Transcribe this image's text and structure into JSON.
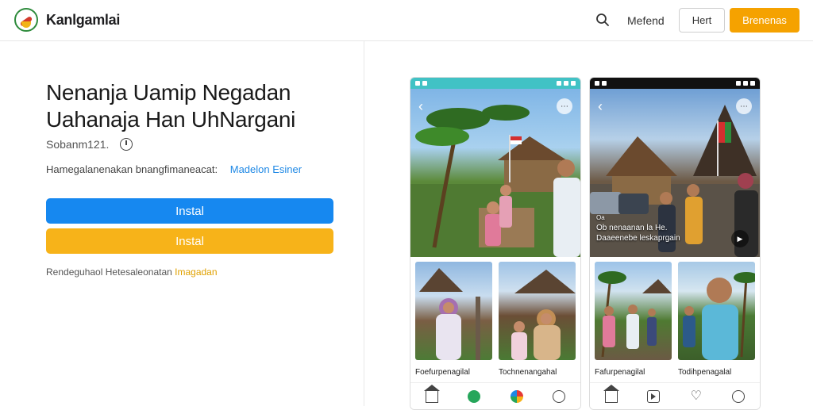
{
  "header": {
    "brand": "Kanlgamlai",
    "nav_link": "Mefend",
    "login_button": "Hert",
    "cta_button": "Brenenas"
  },
  "left": {
    "title_line1": "Nenanja Uamip Negadan",
    "title_line2": "Uahanaja Han UhNargani",
    "meta_text": "Sobanm121.",
    "description": "Hamegalanenakan bnangfimaneacat:",
    "description_link": "Madelon Esiner",
    "install_primary": "Instal",
    "install_secondary": "Instal",
    "foot_note": "Rendeguhaol Hetesaleonatan",
    "foot_note_highlight": "Imagadan"
  },
  "phone1": {
    "status_time": "",
    "tiles": [
      {
        "label": "Foefurpenagilal"
      },
      {
        "label": "Tochnenangahal"
      }
    ]
  },
  "phone2": {
    "caption_line1": "Oa",
    "caption_line2": "Ob nenaanan la He.",
    "caption_line3": "Daaeenebe leskaprgain",
    "tiles": [
      {
        "label": "Fafurpenagilal"
      },
      {
        "label": "Todihpenagalal"
      }
    ]
  },
  "colors": {
    "accent_orange": "#f5a200",
    "install_blue": "#1688f0",
    "install_yellow": "#f7b319",
    "link_blue": "#1e88e5"
  }
}
